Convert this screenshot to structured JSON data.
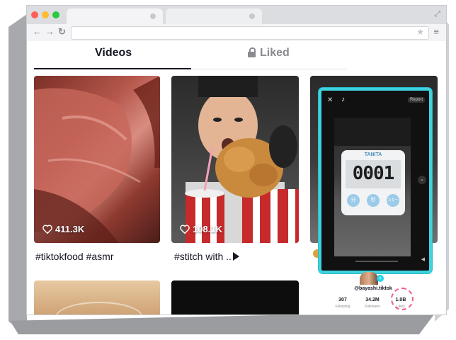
{
  "browser": {
    "nav": {
      "back": "←",
      "forward": "→",
      "reload": "↻",
      "star": "★",
      "menu": "≡",
      "expand": "⤢"
    },
    "url_value": "",
    "traffic_colors": [
      "#ff5f57",
      "#febc2e",
      "#28c840"
    ]
  },
  "profile_tabs": {
    "videos": "Videos",
    "liked": "Liked"
  },
  "videos": [
    {
      "likes": "411.3K",
      "caption": "#tiktokfood #asmr"
    },
    {
      "likes": "108.1K",
      "caption": "#stitch with ..",
      "caption_more": true
    }
  ],
  "player": {
    "app_icon": "tiktok-logo",
    "report": "Report",
    "timer_brand": "TANITA",
    "timer_display": "0001",
    "timer_buttons": [
      "分",
      "秒",
      "スタート"
    ]
  },
  "profile": {
    "username": "@bayashi.tiktok",
    "stats": [
      {
        "value": "307",
        "label": "Following"
      },
      {
        "value": "34.2M",
        "label": "Followers"
      },
      {
        "value": "1.0B",
        "label": "Likes"
      }
    ]
  },
  "colors": {
    "accent": "#3fd3e0",
    "tab_active": "#161823",
    "tab_inactive": "#8a8b91"
  }
}
